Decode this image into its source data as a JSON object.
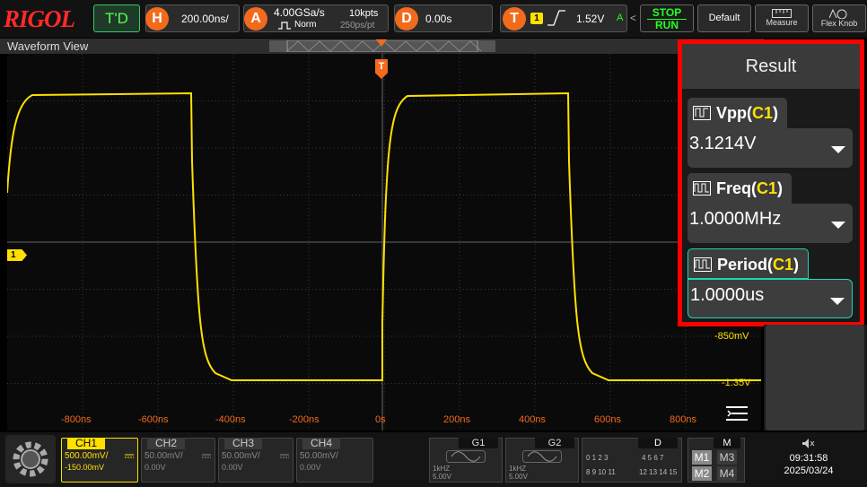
{
  "topbar": {
    "logo": "RIGOL",
    "trigger_mode": "T'D",
    "horizontal": {
      "badge": "H",
      "timebase": "200.00ns/"
    },
    "acquire": {
      "badge": "A",
      "sample_rate": "4.00GSa/s",
      "mode": "Norm",
      "depth": "10kpts",
      "resolution": "250ps/pt"
    },
    "delay": {
      "badge": "D",
      "value": "0.00s"
    },
    "trigger": {
      "badge": "T",
      "source": "1",
      "level": "1.52V",
      "coupling": "A"
    },
    "stop_label": "STOP",
    "run_label": "RUN",
    "default_label": "Default",
    "measure_label": "Measure",
    "flex_label": "Flex Knob"
  },
  "waveform_view": {
    "title": "Waveform View",
    "trigger_marker": "T",
    "channel_marker": "1",
    "x_ticks": [
      "-800ns",
      "-600ns",
      "-400ns",
      "-200ns",
      "0s",
      "200ns",
      "400ns",
      "600ns",
      "800ns"
    ],
    "y_ticks": [
      "-850mV",
      "-1.35V"
    ],
    "trace_color": "#ffe000"
  },
  "result": {
    "title": "Result",
    "items": [
      {
        "name": "Vpp",
        "channel": "C1",
        "value": "3.1214V",
        "selected": false
      },
      {
        "name": "Freq",
        "channel": "C1",
        "value": "1.0000MHz",
        "selected": false
      },
      {
        "name": "Period",
        "channel": "C1",
        "value": "1.0000us",
        "selected": true
      }
    ]
  },
  "channels": [
    {
      "label": "CH1",
      "scale": "500.00mV/",
      "offset": "-150.00mV",
      "active": true
    },
    {
      "label": "CH2",
      "scale": "50.00mV/",
      "offset": "0.00V",
      "active": false
    },
    {
      "label": "CH3",
      "scale": "50.00mV/",
      "offset": "0.00V",
      "active": false
    },
    {
      "label": "CH4",
      "scale": "50.00mV/",
      "offset": "0.00V",
      "active": false
    }
  ],
  "generators": [
    {
      "label": "G1",
      "freq": "1kHZ",
      "amp": "5.00V"
    },
    {
      "label": "G2",
      "freq": "1kHZ",
      "amp": "5.00V"
    }
  ],
  "digital": {
    "label": "D",
    "row1a": "0 1 2 3",
    "row1b": "4 5 6 7",
    "row2a": "8 9 10 11",
    "row2b": "12 13 14 15"
  },
  "math": {
    "label": "M",
    "buttons": [
      "M1",
      "M3",
      "M2",
      "M4"
    ]
  },
  "status": {
    "time": "09:31:58",
    "date": "2025/03/24"
  },
  "colors": {
    "accent": "#f26a1b",
    "channel1": "#ffe000",
    "highlight": "#ff0000",
    "selected_border": "#19d9b5"
  }
}
